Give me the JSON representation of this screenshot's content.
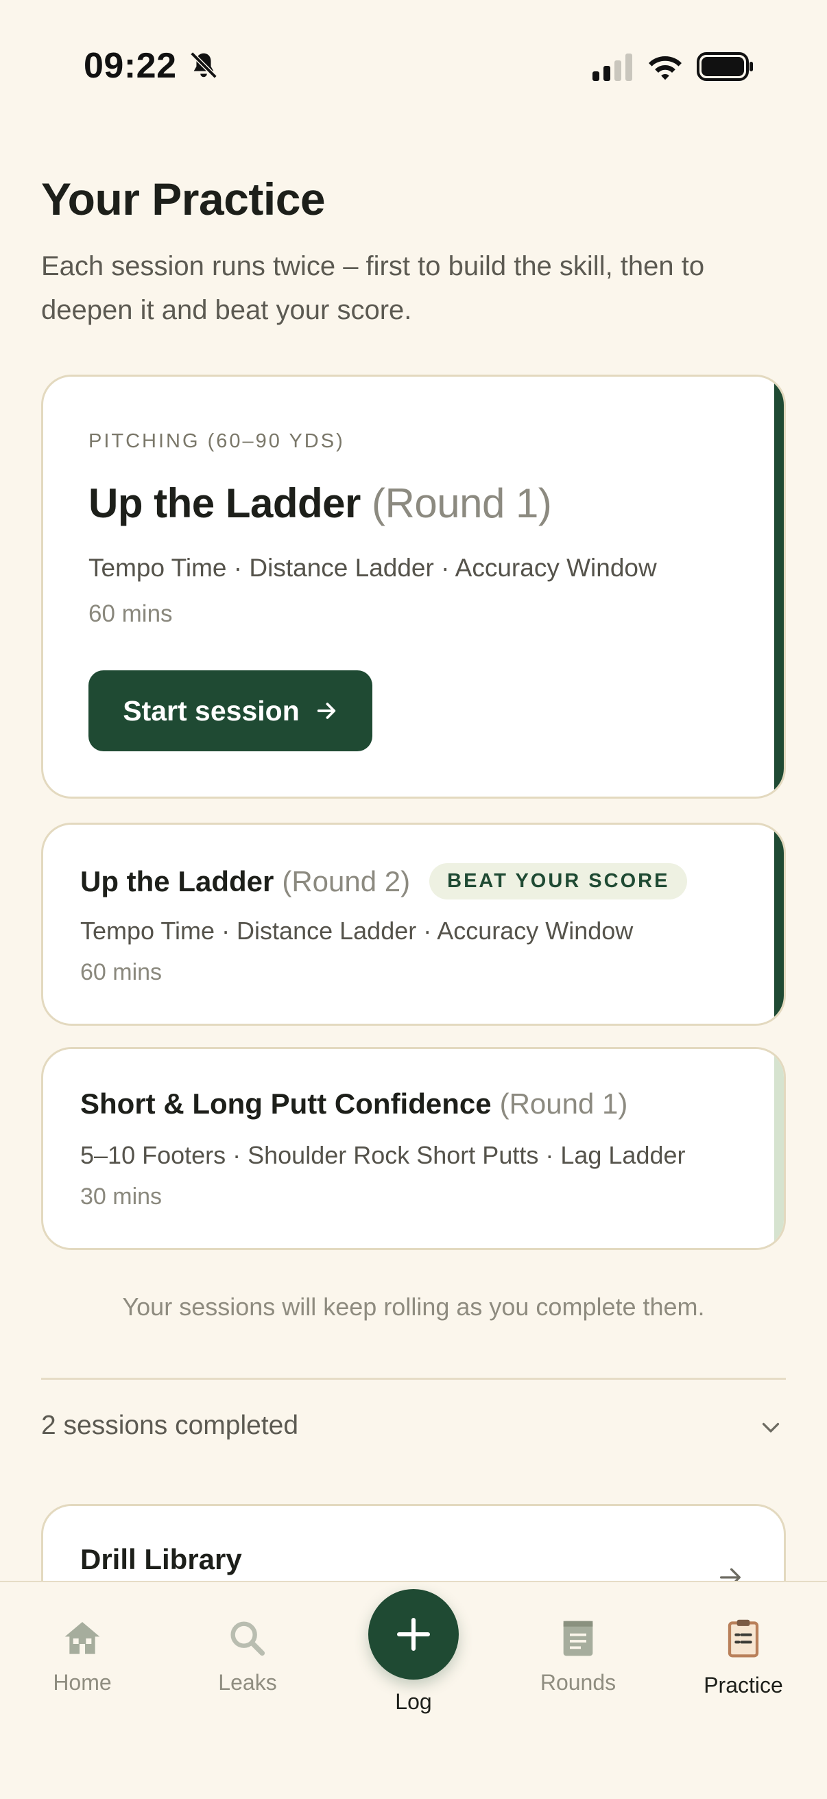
{
  "status_bar": {
    "time": "09:22"
  },
  "header": {
    "title": "Your Practice",
    "subtitle": "Each session runs twice – first to build the skill, then to deepen it and beat your score."
  },
  "sessions": [
    {
      "category": "PITCHING (60–90 YDS)",
      "name": "Up the Ladder",
      "round": "(Round 1)",
      "drills": "Tempo Time · Distance Ladder · Accuracy Window",
      "duration": "60 mins",
      "cta": "Start session",
      "accent": "#1f4a33"
    },
    {
      "name": "Up the Ladder",
      "round": "(Round 2)",
      "badge": "BEAT YOUR SCORE",
      "drills": "Tempo Time · Distance Ladder · Accuracy Window",
      "duration": "60 mins",
      "accent": "#1f4a33"
    },
    {
      "name": "Short & Long Putt Confidence",
      "round": "(Round 1)",
      "drills": "5–10 Footers · Shoulder Rock Short Putts · Lag Ladder",
      "duration": "30 mins",
      "accent": "#d6e3cf"
    }
  ],
  "rolling_note": "Your sessions will keep rolling as you complete them.",
  "completed": {
    "label": "2 sessions completed",
    "icon": "chevron-down-icon"
  },
  "library": {
    "title": "Drill Library",
    "icon": "arrow-right-icon"
  },
  "nav": {
    "items": [
      {
        "label": "Home",
        "icon": "home-icon"
      },
      {
        "label": "Leaks",
        "icon": "search-icon"
      },
      {
        "label": "Log",
        "icon": "plus-icon"
      },
      {
        "label": "Rounds",
        "icon": "scorecard-icon"
      },
      {
        "label": "Practice",
        "icon": "clipboard-icon",
        "active": true
      }
    ]
  },
  "colors": {
    "brand": "#1f4a33",
    "background": "#fbf6ec",
    "card_border": "#e3d9bf"
  }
}
